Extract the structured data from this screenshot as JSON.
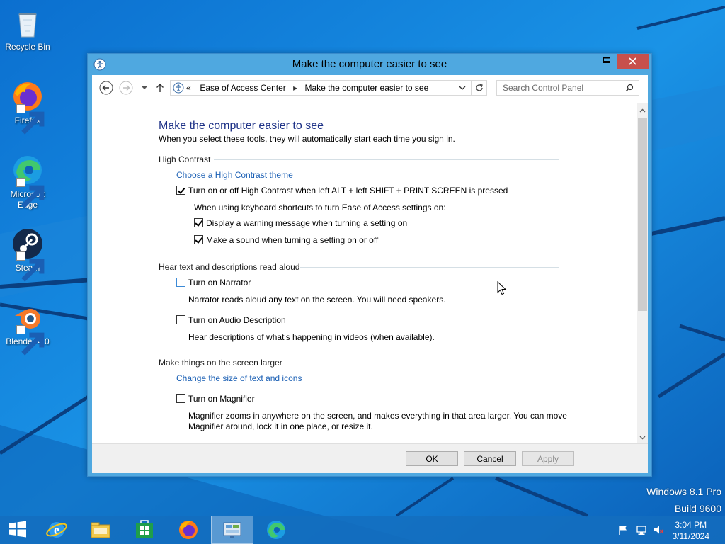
{
  "desktop": {
    "icons": [
      {
        "label": "Recycle Bin"
      },
      {
        "label": "Firefox"
      },
      {
        "label": "Microsoft Edge"
      },
      {
        "label": "Steam"
      },
      {
        "label": "Blender 4.0"
      }
    ],
    "watermark_line1": "Windows 8.1 Pro",
    "watermark_line2": "Build 9600"
  },
  "window": {
    "title": "Make the computer easier to see",
    "address": {
      "overflow": "«",
      "crumb1": "Ease of Access Center",
      "crumb2": "Make the computer easier to see"
    },
    "search_placeholder": "Search Control Panel",
    "heading": "Make the computer easier to see",
    "subheading": "When you select these tools, they will automatically start each time you sign in.",
    "sections": {
      "high_contrast": {
        "title": "High Contrast",
        "link": "Choose a High Contrast theme",
        "toggle_label": "Turn on or off High Contrast when left ALT + left SHIFT + PRINT SCREEN is pressed",
        "toggle_checked": true,
        "note": "When using keyboard shortcuts to turn Ease of Access settings on:",
        "warning_label": "Display a warning message when turning a setting on",
        "warning_checked": true,
        "sound_label": "Make a sound when turning a setting on or off",
        "sound_checked": true
      },
      "read_aloud": {
        "title": "Hear text and descriptions read aloud",
        "narrator_label": "Turn on Narrator",
        "narrator_checked": false,
        "narrator_desc": "Narrator reads aloud any text on the screen. You will need speakers.",
        "audio_label": "Turn on Audio Description",
        "audio_checked": false,
        "audio_desc": "Hear descriptions of what's happening in videos (when available)."
      },
      "larger": {
        "title": "Make things on the screen larger",
        "link": "Change the size of text and icons",
        "magnifier_label": "Turn on Magnifier",
        "magnifier_checked": false,
        "magnifier_desc": "Magnifier zooms in anywhere on the screen, and makes everything in that area larger. You can move Magnifier around, lock it in one place, or resize it."
      }
    },
    "buttons": {
      "ok": "OK",
      "cancel": "Cancel",
      "apply": "Apply"
    }
  },
  "taskbar": {
    "items": [
      "start-button",
      "internet-explorer",
      "file-explorer",
      "windows-store",
      "firefox",
      "control-panel",
      "microsoft-edge"
    ],
    "active_item": "control-panel",
    "clock_time": "3:04 PM",
    "clock_date": "3/11/2024"
  },
  "colors": {
    "desktop_blue": "#1a8fe3",
    "window_frame": "#4fa8e0",
    "close_red": "#c7504c",
    "heading_blue": "#1e3287",
    "link_blue": "#1a5fb4"
  }
}
